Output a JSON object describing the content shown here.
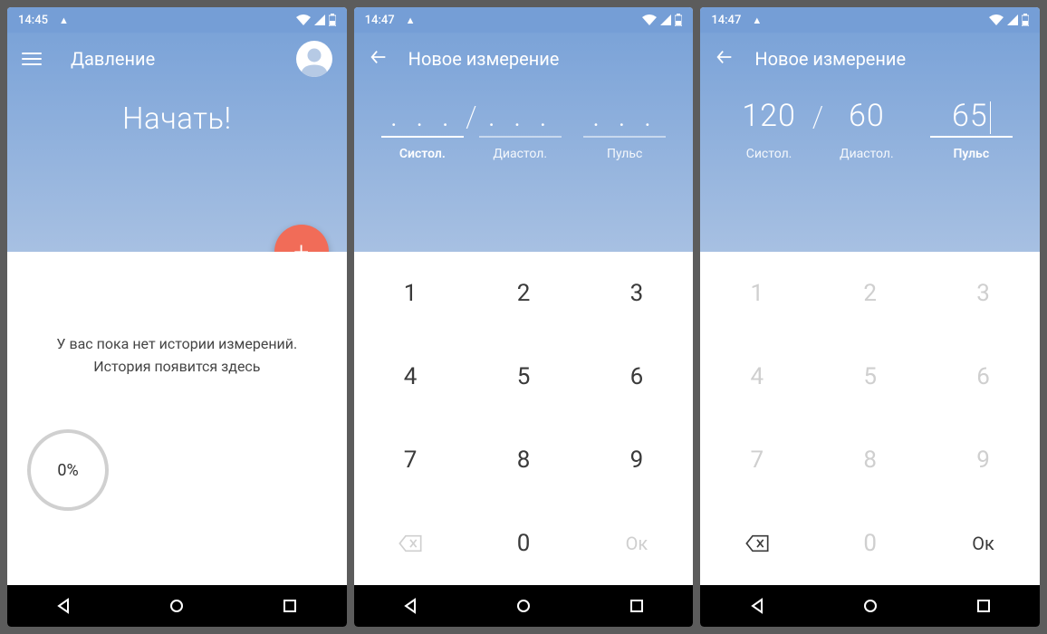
{
  "screens": [
    {
      "status": {
        "time": "14:45"
      },
      "topbar": {
        "title": "Давление"
      },
      "headline": "Начать!",
      "fab": "+",
      "empty_message": "У вас пока нет истории измерений. История появится здесь",
      "progress": "0%"
    },
    {
      "status": {
        "time": "14:47"
      },
      "topbar": {
        "title": "Новое измерение"
      },
      "fields": {
        "systolic": {
          "value": ". . .",
          "label": "Систол.",
          "active": true,
          "filled": false
        },
        "diastolic": {
          "value": ". . .",
          "label": "Диастол.",
          "active": false,
          "filled": false
        },
        "pulse": {
          "value": ". . .",
          "label": "Пульс",
          "active": false,
          "filled": false
        }
      },
      "keypad": {
        "keys": [
          "1",
          "2",
          "3",
          "4",
          "5",
          "6",
          "7",
          "8",
          "9"
        ],
        "zero": "0",
        "ok": "Ок",
        "backspace_active": false,
        "ok_active": false,
        "digits_active": true
      }
    },
    {
      "status": {
        "time": "14:47"
      },
      "topbar": {
        "title": "Новое измерение"
      },
      "fields": {
        "systolic": {
          "value": "120",
          "label": "Систол.",
          "active": false,
          "filled": true
        },
        "diastolic": {
          "value": "60",
          "label": "Диастол.",
          "active": false,
          "filled": true
        },
        "pulse": {
          "value": "65",
          "label": "Пульс",
          "active": true,
          "filled": true
        }
      },
      "keypad": {
        "keys": [
          "1",
          "2",
          "3",
          "4",
          "5",
          "6",
          "7",
          "8",
          "9"
        ],
        "zero": "0",
        "ok": "Ок",
        "backspace_active": true,
        "ok_active": true,
        "digits_active": false
      }
    }
  ]
}
